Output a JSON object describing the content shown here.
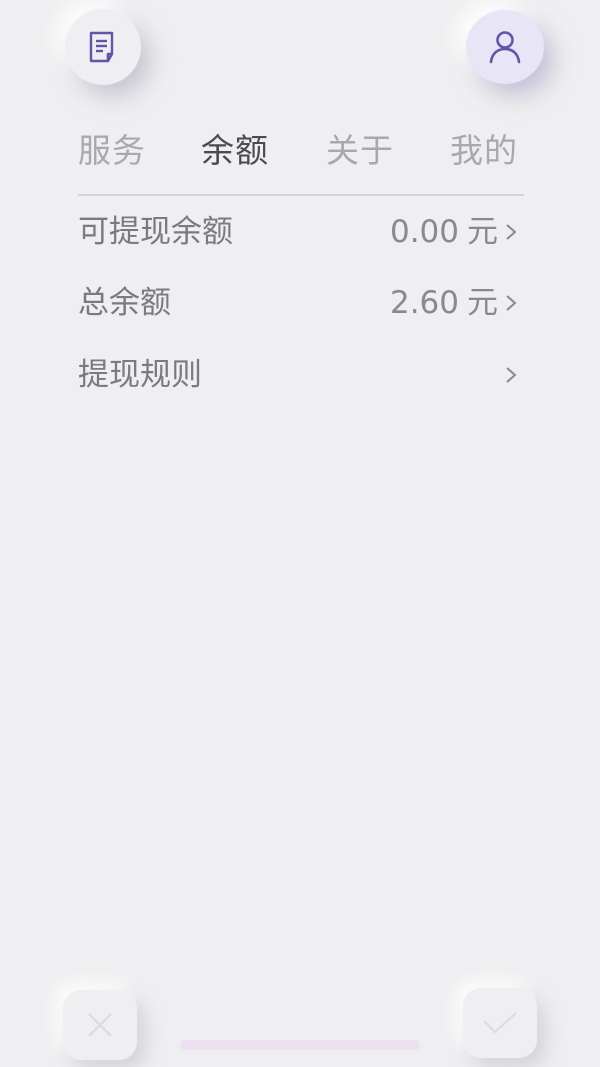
{
  "header": {
    "left_icon": "document-icon",
    "right_icon": "user-icon",
    "accent_color": "#6a5fb0"
  },
  "tabs": [
    {
      "label": "服务",
      "active": false
    },
    {
      "label": "余额",
      "active": true
    },
    {
      "label": "关于",
      "active": false
    },
    {
      "label": "我的",
      "active": false
    }
  ],
  "rows": [
    {
      "label": "可提现余额",
      "amount": "0.00",
      "unit": "元"
    },
    {
      "label": "总余额",
      "amount": "2.60",
      "unit": "元"
    },
    {
      "label": "提现规则"
    }
  ],
  "footer": {
    "cancel_icon": "close-icon",
    "confirm_icon": "check-icon"
  }
}
